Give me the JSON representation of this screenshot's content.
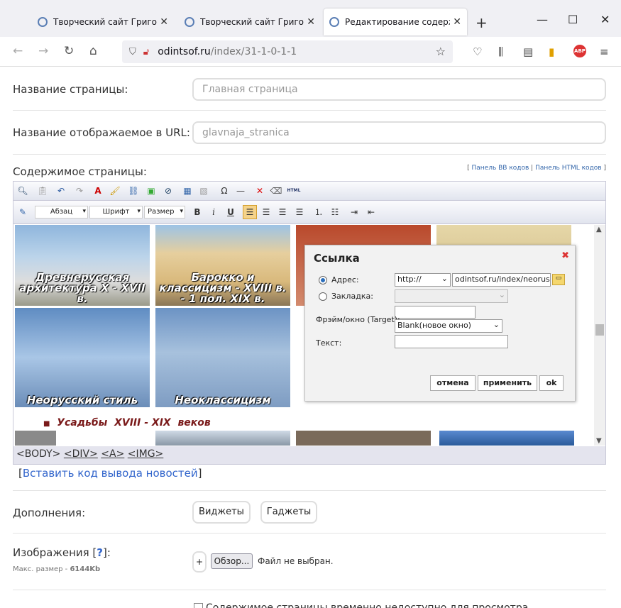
{
  "browser": {
    "tabs": [
      {
        "title": "Творческий сайт Григория",
        "close": "✕"
      },
      {
        "title": "Творческий сайт Григория",
        "close": "✕"
      },
      {
        "title": "Редактирование содержимого",
        "close": "✕"
      }
    ],
    "new_tab": "+",
    "window": {
      "minimize": "—",
      "maximize": "☐",
      "close": "✕"
    },
    "url_host": "odintsof.ru",
    "url_path": "/index/31-1-0-1-1"
  },
  "form": {
    "page_name_label": "Название страницы:",
    "page_name_placeholder": "Главная страница",
    "url_name_label": "Название отображаемое в URL:",
    "url_name_placeholder": "glavnaja_stranica",
    "content_label": "Содержимое страницы:",
    "panel_links": {
      "open": "[",
      "bb": "Панель BB кодов",
      "sep": "|",
      "html": "Панель HTML кодов",
      "close": "]"
    },
    "news_code_link": "Вставить код вывода новостей",
    "addons_label": "Дополнения:",
    "widgets_button": "Виджеты",
    "gadgets_button": "Гаджеты",
    "images_label": "Изображения [",
    "images_help": "?",
    "images_label_end": "]:",
    "max_size_label": "Макс. размер -",
    "max_size_value": "6144Kb",
    "add_button": "+",
    "browse_button": "Обзор...",
    "no_file": "Файл не выбран.",
    "unavailable_checkbox": "Содержимое страницы временно недоступно для просмотра"
  },
  "editor": {
    "format_select": "Абзац",
    "font_select": "Шрифт",
    "size_select": "Размер",
    "html_button": "HTML",
    "captions": [
      "Древнерусская архитектура X - XVII в.",
      "Барокко и классицизм - XVIII в. - 1 пол. XIX в.",
      "Неорусский стиль",
      "Неоклассицизм"
    ],
    "list_heading": "Усадьбы  XVIII - XIX  веков",
    "path": [
      "<BODY>",
      "<DIV>",
      "<A>",
      "<IMG>"
    ]
  },
  "dialog": {
    "title": "Ссылка",
    "address_label": "Адрес:",
    "protocol": "http://",
    "address_value": "odintsof.ru/index/neorusskij",
    "bookmark_label": "Закладка:",
    "target_label": "Фрэйм/окно (Target):",
    "target_value": "Blank(новое окно)",
    "text_label": "Текст:",
    "cancel": "отмена",
    "apply": "применить",
    "ok": "ok"
  }
}
